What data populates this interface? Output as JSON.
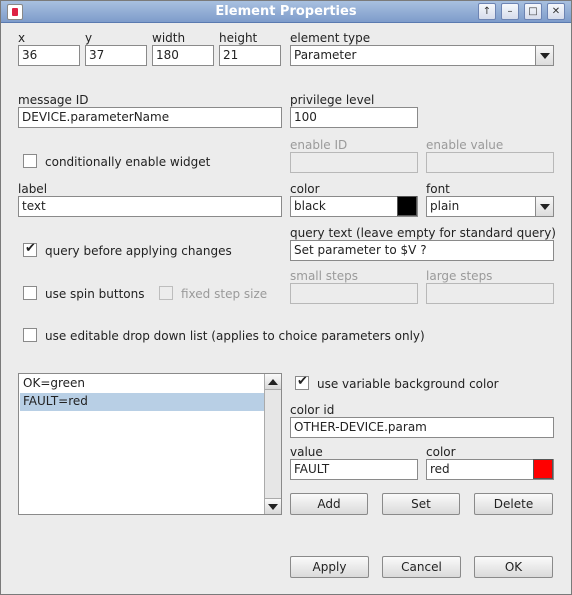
{
  "window": {
    "title": "Element Properties",
    "controls": [
      "↑",
      "–",
      "□",
      "✕"
    ]
  },
  "position": {
    "x_label": "x",
    "x_value": "36",
    "y_label": "y",
    "y_value": "37",
    "width_label": "width",
    "width_value": "180",
    "height_label": "height",
    "height_value": "21"
  },
  "element_type": {
    "label": "element type",
    "value": "Parameter"
  },
  "message_id": {
    "label": "message ID",
    "value": "DEVICE.parameterName"
  },
  "privilege_level": {
    "label": "privilege level",
    "value": "100"
  },
  "conditional": {
    "checkbox_label": "conditionally enable widget",
    "checked": false,
    "enable_id_label": "enable ID",
    "enable_id_value": "",
    "enable_value_label": "enable value",
    "enable_value_value": ""
  },
  "label_field": {
    "label": "label",
    "value": "text"
  },
  "color_field": {
    "label": "color",
    "value": "black",
    "swatch": "#000000"
  },
  "font_field": {
    "label": "font",
    "value": "plain"
  },
  "query": {
    "checkbox_label": "query before applying changes",
    "checked": true,
    "text_label": "query text (leave empty for standard query)",
    "text_value": "Set parameter to $V ?"
  },
  "spin": {
    "checkbox_label": "use spin buttons",
    "checked": false,
    "fixed_label": "fixed step size",
    "fixed_checked": false,
    "small_steps_label": "small steps",
    "small_steps_value": "",
    "large_steps_label": "large steps",
    "large_steps_value": ""
  },
  "editable_dropdown": {
    "checkbox_label": "use editable drop down list (applies to choice parameters only)",
    "checked": false
  },
  "color_map": {
    "items": [
      "OK=green",
      "FAULT=red"
    ],
    "selected_index": 1
  },
  "variable_bg": {
    "checkbox_label": "use variable background color",
    "checked": true,
    "color_id_label": "color id",
    "color_id_value": "OTHER-DEVICE.param",
    "value_label": "value",
    "value_value": "FAULT",
    "color_label": "color",
    "color_value": "red",
    "swatch": "#ff0000"
  },
  "list_buttons": {
    "add": "Add",
    "set": "Set",
    "delete": "Delete"
  },
  "footer": {
    "apply": "Apply",
    "cancel": "Cancel",
    "ok": "OK"
  }
}
